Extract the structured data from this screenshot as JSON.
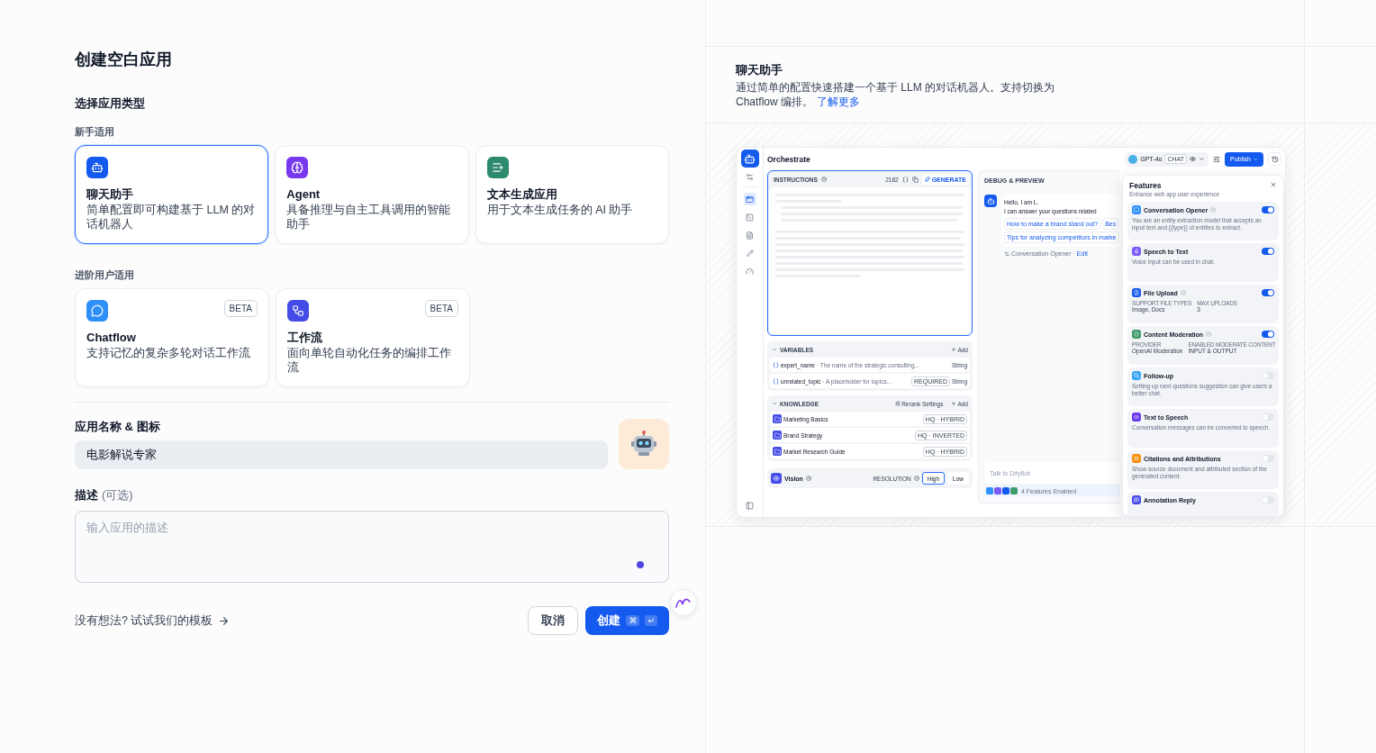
{
  "title": "创建空白应用",
  "type_label": "选择应用类型",
  "groups": [
    {
      "label": "新手适用",
      "cards": [
        {
          "kind": "chat",
          "title": "聊天助手",
          "desc": "简单配置即可构建基于 LLM 的对话机器人",
          "selected": true
        },
        {
          "kind": "agent",
          "title": "Agent",
          "desc": "具备推理与自主工具调用的智能助手",
          "selected": false
        },
        {
          "kind": "completion",
          "title": "文本生成应用",
          "desc": "用于文本生成任务的 AI 助手",
          "selected": false
        }
      ]
    },
    {
      "label": "进阶用户适用",
      "cards": [
        {
          "kind": "chatflow",
          "title": "Chatflow",
          "desc": "支持记忆的复杂多轮对话工作流",
          "badge": "BETA",
          "selected": false
        },
        {
          "kind": "workflow",
          "title": "工作流",
          "desc": "面向单轮自动化任务的编排工作流",
          "badge": "BETA",
          "selected": false
        }
      ]
    }
  ],
  "name_section": {
    "label": "应用名称 & 图标",
    "value": "电影解说专家"
  },
  "description": {
    "label": "描述",
    "optional": "(可选)",
    "placeholder": "输入应用的描述"
  },
  "template_link": "没有想法? 试试我们的模板",
  "buttons": {
    "cancel": "取消",
    "create": "创建",
    "keys": [
      "⌘",
      "↵"
    ]
  },
  "preview": {
    "title": "聊天助手",
    "text": "通过简单的配置快速搭建一个基于 LLM 的对话机器人。支持切换为 Chatflow 编排。",
    "link": "了解更多",
    "app": {
      "header": "Orchestrate",
      "model": "GPT-4o",
      "model_tag": "CHAT",
      "publish": "Publish",
      "instructions": {
        "label": "INSTRUCTIONS",
        "count": "2182",
        "generate": "GENERATE"
      },
      "variables": {
        "label": "VARIABLES",
        "add": "Add",
        "rows": [
          {
            "name": "expert_name",
            "desc": "· The name of the strategic consulting...",
            "required": false,
            "type": "String"
          },
          {
            "name": "unrelated_topic",
            "desc": "· A placeholder for topics...",
            "required": true,
            "required_label": "REQUIRED",
            "type": "String"
          }
        ]
      },
      "knowledge": {
        "label": "KNOWLEDGE",
        "rerank": "Rerank Settings",
        "add": "Add",
        "items": [
          {
            "name": "Marketing Basics",
            "tag": "HQ · HYBRID"
          },
          {
            "name": "Brand Strategy",
            "tag": "HQ · INVERTED"
          },
          {
            "name": "Market Research Guide",
            "tag": "HQ · HYBRID"
          }
        ]
      },
      "vision": {
        "label": "Vision",
        "resolution": "RESOLUTION",
        "options": [
          {
            "label": "High",
            "selected": true
          },
          {
            "label": "Low",
            "selected": false
          }
        ]
      },
      "debug": {
        "label": "DEBUG & PREVIEW",
        "greeting": [
          "Hello, I am L.",
          "I can answer your questions related"
        ],
        "suggestions": [
          [
            "How to make a brand stand out?",
            "Bes"
          ],
          [
            "Tips for analyzing competitors in marke"
          ]
        ],
        "opener": "Conversation Opener ·",
        "edit": "Edit",
        "input_placeholder": "Talk to DifyBot",
        "features_enabled": "4 Features Enabled"
      },
      "features": {
        "title": "Features",
        "subtitle": "Enhance web app user experience",
        "items": [
          {
            "kind": "text",
            "name": "Conversation Opener",
            "help": true,
            "on": true,
            "color": "#2e90fa",
            "desc": "You are an entity extraction model that accepts an input text and {{type}} of entities to extract."
          },
          {
            "kind": "text",
            "name": "Speech to Text",
            "help": false,
            "on": true,
            "color": "#7a5af8",
            "desc": "Voice input can be used in chat."
          },
          {
            "kind": "fields",
            "name": "File Upload",
            "help": true,
            "on": true,
            "color": "#155aef",
            "fields": [
              {
                "label": "SUPPORT FILE TYPES",
                "value": "Image, Docs"
              },
              {
                "label": "MAX UPLOADS",
                "value": "3"
              }
            ]
          },
          {
            "kind": "fields",
            "name": "Content Moderation",
            "help": true,
            "on": true,
            "color": "#3f9d6b",
            "fields": [
              {
                "label": "PROVIDER",
                "value": "OpenAI Moderation"
              },
              {
                "label": "ENABLED MODERATE CONTENT",
                "value": "INPUT & OUTPUT"
              }
            ]
          },
          {
            "kind": "text",
            "name": "Follow-up",
            "help": false,
            "on": false,
            "color": "#36a3f7",
            "desc": "Setting up next questions suggestion can give users a better chat."
          },
          {
            "kind": "text",
            "name": "Text to Speech",
            "help": false,
            "on": false,
            "color": "#6938ef",
            "desc": "Conversation messages can be converted to speech."
          },
          {
            "kind": "text",
            "name": "Citations and Attributions",
            "help": false,
            "on": false,
            "color": "#f79009",
            "desc": "Show source document and attributed section of the generated content."
          },
          {
            "kind": "text",
            "name": "Annotation Reply",
            "help": false,
            "on": false,
            "color": "#444ce7"
          }
        ]
      }
    }
  }
}
